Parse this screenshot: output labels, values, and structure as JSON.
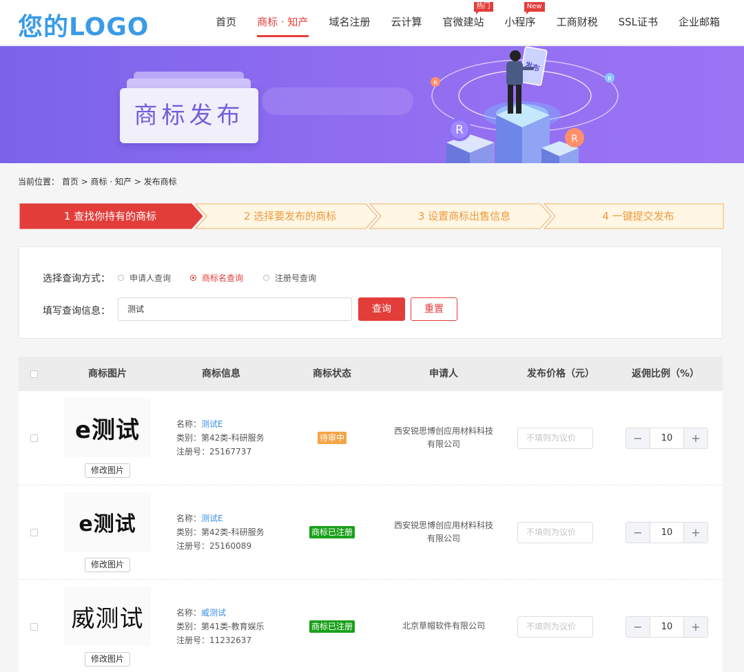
{
  "header": {
    "logo": "您的LOGO",
    "nav": [
      {
        "label": "首页",
        "badge": ""
      },
      {
        "label": "商标 · 知产",
        "badge": "",
        "active": true
      },
      {
        "label": "域名注册",
        "badge": ""
      },
      {
        "label": "云计算",
        "badge": ""
      },
      {
        "label": "官微建站",
        "badge": "热门"
      },
      {
        "label": "小程序",
        "badge": "New"
      },
      {
        "label": "工商财税",
        "badge": ""
      },
      {
        "label": "SSL证书",
        "badge": ""
      },
      {
        "label": "企业邮箱",
        "badge": ""
      }
    ]
  },
  "banner": {
    "title": "商标发布",
    "badge_letter": "R",
    "sign_text": "发布"
  },
  "breadcrumb": "当前位置： 首页 > 商标 · 知产 > 发布商标",
  "steps": [
    {
      "label": "1 查找你持有的商标",
      "active": true
    },
    {
      "label": "2 选择要发布的商标",
      "active": false
    },
    {
      "label": "3 设置商标出售信息",
      "active": false
    },
    {
      "label": "4 一键提交发布",
      "active": false
    }
  ],
  "search": {
    "method_label": "选择查询方式：",
    "options": [
      "申请人查询",
      "商标名查询",
      "注册号查询"
    ],
    "selected": "商标名查询",
    "info_label": "填写查询信息：",
    "value": "测试",
    "query_button": "查询",
    "reset_button": "重置"
  },
  "table": {
    "columns": [
      "商标图片",
      "商标信息",
      "商标状态",
      "申请人",
      "发布价格（元）",
      "返佣比例（%）"
    ],
    "rows": [
      {
        "logo_text": "e测试",
        "edit_button": "修改图片",
        "name_label": "名称：",
        "name": "测试E",
        "category": "类别：第42类-科研服务",
        "reg_no": "注册号：25167737",
        "status": "待审中",
        "applicant": "西安锐思博创应用材料科技有限公司",
        "price_placeholder": "不填则为议价",
        "commission": "10"
      },
      {
        "logo_text": "e测试",
        "edit_button": "修改图片",
        "name_label": "名称：",
        "name": "测试E",
        "category": "类别：第42类-科研服务",
        "reg_no": "注册号：25160089",
        "status": "商标已注册",
        "applicant": "西安锐思博创应用材料科技有限公司",
        "price_placeholder": "不填则为议价",
        "commission": "10"
      },
      {
        "logo_text": "威测试",
        "edit_button": "修改图片",
        "name_label": "名称：",
        "name": "威测试",
        "category": "类别：第41类-教育娱乐",
        "reg_no": "注册号：11232637",
        "status": "商标已注册",
        "applicant": "北京草帽软件有限公司",
        "price_placeholder": "不填则为议价",
        "commission": "10"
      }
    ],
    "minus": "−",
    "plus": "+"
  },
  "colors": {
    "accent": "#e33d3a",
    "logo": "#3a9be8",
    "banner": "#8f6cf0",
    "pending": "#f5a445",
    "registered": "#1aa01a"
  }
}
